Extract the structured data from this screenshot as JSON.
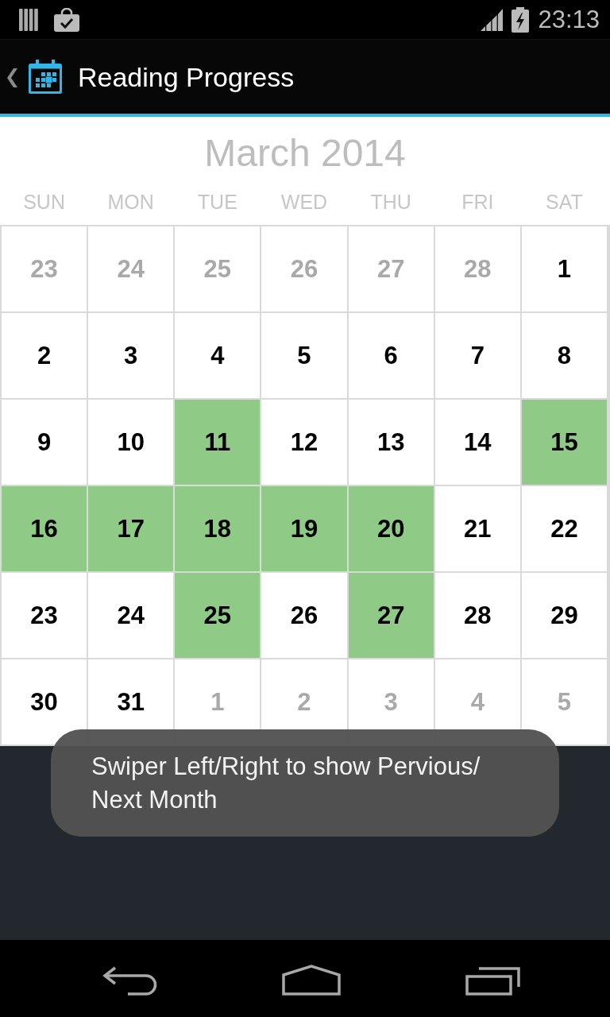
{
  "status_bar": {
    "time": "23:13"
  },
  "action_bar": {
    "title": "Reading Progress"
  },
  "calendar": {
    "month_title": "March 2014",
    "weekdays": [
      "SUN",
      "MON",
      "TUE",
      "WED",
      "THU",
      "FRI",
      "SAT"
    ],
    "weeks": [
      {
        "days": [
          {
            "day": "23",
            "in_month": false,
            "highlighted": false
          },
          {
            "day": "24",
            "in_month": false,
            "highlighted": false
          },
          {
            "day": "25",
            "in_month": false,
            "highlighted": false
          },
          {
            "day": "26",
            "in_month": false,
            "highlighted": false
          },
          {
            "day": "27",
            "in_month": false,
            "highlighted": false
          },
          {
            "day": "28",
            "in_month": false,
            "highlighted": false
          },
          {
            "day": "1",
            "in_month": true,
            "highlighted": false
          }
        ]
      },
      {
        "days": [
          {
            "day": "2",
            "in_month": true,
            "highlighted": false
          },
          {
            "day": "3",
            "in_month": true,
            "highlighted": false
          },
          {
            "day": "4",
            "in_month": true,
            "highlighted": false
          },
          {
            "day": "5",
            "in_month": true,
            "highlighted": false
          },
          {
            "day": "6",
            "in_month": true,
            "highlighted": false
          },
          {
            "day": "7",
            "in_month": true,
            "highlighted": false
          },
          {
            "day": "8",
            "in_month": true,
            "highlighted": false
          }
        ]
      },
      {
        "days": [
          {
            "day": "9",
            "in_month": true,
            "highlighted": false
          },
          {
            "day": "10",
            "in_month": true,
            "highlighted": false
          },
          {
            "day": "11",
            "in_month": true,
            "highlighted": true
          },
          {
            "day": "12",
            "in_month": true,
            "highlighted": false
          },
          {
            "day": "13",
            "in_month": true,
            "highlighted": false
          },
          {
            "day": "14",
            "in_month": true,
            "highlighted": false
          },
          {
            "day": "15",
            "in_month": true,
            "highlighted": true
          }
        ]
      },
      {
        "days": [
          {
            "day": "16",
            "in_month": true,
            "highlighted": true
          },
          {
            "day": "17",
            "in_month": true,
            "highlighted": true
          },
          {
            "day": "18",
            "in_month": true,
            "highlighted": true
          },
          {
            "day": "19",
            "in_month": true,
            "highlighted": true
          },
          {
            "day": "20",
            "in_month": true,
            "highlighted": true
          },
          {
            "day": "21",
            "in_month": true,
            "highlighted": false
          },
          {
            "day": "22",
            "in_month": true,
            "highlighted": false
          }
        ]
      },
      {
        "days": [
          {
            "day": "23",
            "in_month": true,
            "highlighted": false
          },
          {
            "day": "24",
            "in_month": true,
            "highlighted": false
          },
          {
            "day": "25",
            "in_month": true,
            "highlighted": true
          },
          {
            "day": "26",
            "in_month": true,
            "highlighted": false
          },
          {
            "day": "27",
            "in_month": true,
            "highlighted": true
          },
          {
            "day": "28",
            "in_month": true,
            "highlighted": false
          },
          {
            "day": "29",
            "in_month": true,
            "highlighted": false
          }
        ]
      },
      {
        "days": [
          {
            "day": "30",
            "in_month": true,
            "highlighted": false
          },
          {
            "day": "31",
            "in_month": true,
            "highlighted": false
          },
          {
            "day": "1",
            "in_month": false,
            "highlighted": false
          },
          {
            "day": "2",
            "in_month": false,
            "highlighted": false
          },
          {
            "day": "3",
            "in_month": false,
            "highlighted": false
          },
          {
            "day": "4",
            "in_month": false,
            "highlighted": false
          },
          {
            "day": "5",
            "in_month": false,
            "highlighted": false
          }
        ]
      }
    ]
  },
  "toast": {
    "text": "Swiper Left/Right to show Pervious/ Next Month"
  }
}
